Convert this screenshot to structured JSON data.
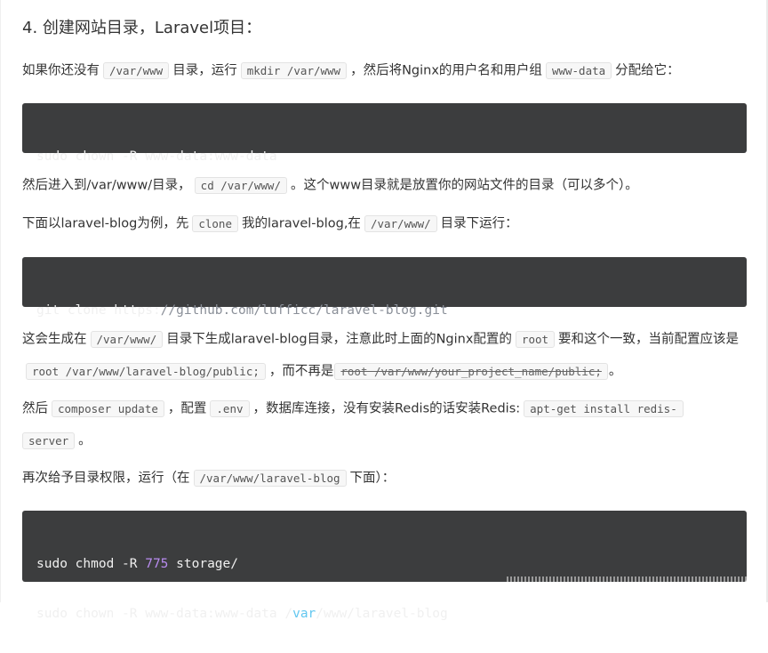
{
  "heading": "4. 创建网站目录，Laravel项目：",
  "p1": {
    "t1": "如果你还没有",
    "c1": "/var/www",
    "t2": "目录，运行",
    "c2": "mkdir /var/www",
    "t3": "，然后将Nginx的用户名和用户组",
    "c3": "www-data",
    "t4": "分配给它："
  },
  "code1": {
    "line1": "sudo chown -R www-data:www-data"
  },
  "p2": {
    "t1": "然后进入到/var/www/目录，",
    "c1": "cd /var/www/",
    "t2": "。这个www目录就是放置你的网站文件的目录（可以多个）。"
  },
  "p3": {
    "t1": "下面以laravel-blog为例，先",
    "c1": "clone",
    "t2": "我的laravel-blog,在",
    "c2": "/var/www/",
    "t3": "目录下运行："
  },
  "code2": {
    "cmd": "git clone https:",
    "comment": "//github.com/lufficc/laravel-blog.git"
  },
  "p4": {
    "t1": "这会生成在",
    "c1": "/var/www/",
    "t2": "目录下生成laravel-blog目录，注意此时上面的Nginx配置的",
    "c2": "root",
    "t3": "要和这个一致，当前配置应该是",
    "c3": "root /var/www/laravel-blog/public;",
    "t4": "，而不再是",
    "c4": "root /var/www/your_project_name/public;",
    "t5": "。"
  },
  "p5": {
    "t1": "然后",
    "c1": "composer update",
    "t2": "，配置",
    "c2": ".env",
    "t3": "，数据库连接，没有安装Redis的话安装Redis:",
    "c3a": "apt-get install redis-",
    "c3b": "server",
    "t4": "。"
  },
  "p6": {
    "t1": "再次给予目录权限，运行（在",
    "c1": "/var/www/laravel-blog",
    "t2": "下面）："
  },
  "code3": {
    "l1a": "sudo chmod -R ",
    "l1num": "775",
    "l1b": " storage/",
    "l2a": "sudo chown -R www-data:www-data /",
    "l2kw": "var",
    "l2b": "/www/laravel-blog"
  }
}
